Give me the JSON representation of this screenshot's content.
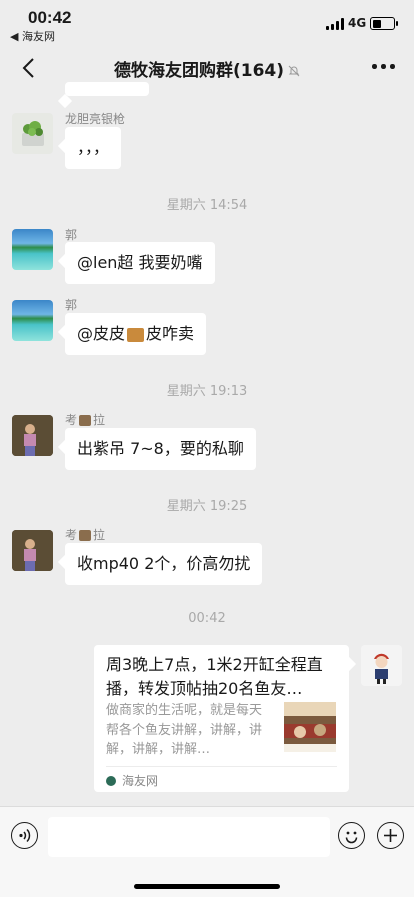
{
  "status_bar": {
    "time": "00:42",
    "back_app": "◀ 海友网",
    "network": "4G"
  },
  "nav": {
    "title": "德牧海友团购群(164)"
  },
  "messages": [
    {
      "sender": "龙胆亮银枪",
      "text": "，，，"
    },
    {
      "timestamp": "星期六 14:54"
    },
    {
      "sender": "郭",
      "text": "@len超 我要奶嘴"
    },
    {
      "sender": "郭",
      "text_a": "@皮皮",
      "text_b": "皮咋卖"
    },
    {
      "timestamp": "星期六 19:13"
    },
    {
      "sender_a": "考",
      "sender_b": "拉",
      "text": "出紫吊 7~8，要的私聊"
    },
    {
      "timestamp": "星期六 19:25"
    },
    {
      "sender_a": "考",
      "sender_b": "拉",
      "text": "收mp40 2个，价高勿扰"
    },
    {
      "timestamp": "00:42"
    }
  ],
  "link_card": {
    "title": "周3晚上7点，1米2开缸全程直播，转发顶帖抽20名鱼友…",
    "description": "做商家的生活呢，就是每天帮各个鱼友讲解，讲解，讲解，讲解，讲解…",
    "source": "海友网"
  }
}
